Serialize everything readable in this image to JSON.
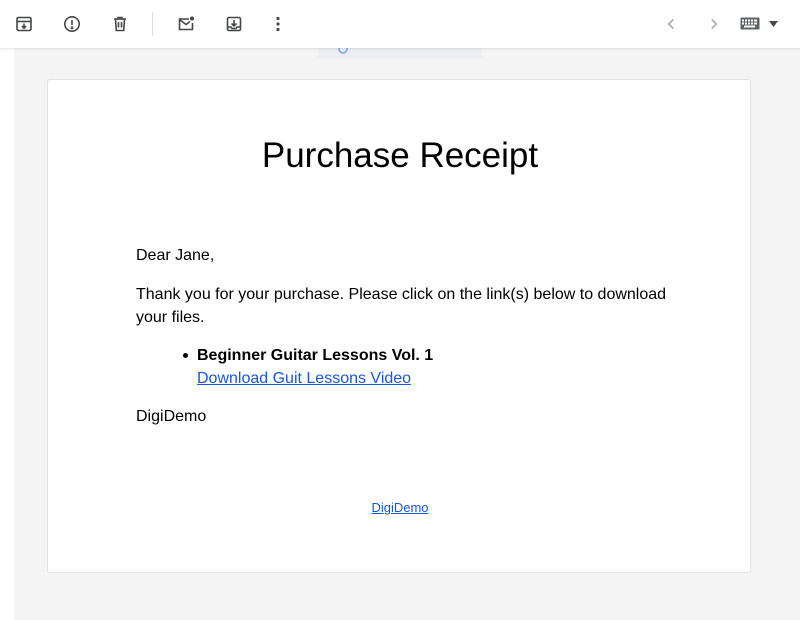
{
  "toolbar": {
    "icons": [
      "archive-icon",
      "report-spam-icon",
      "delete-icon",
      "mark-unread-icon",
      "move-to-icon",
      "more-vert-icon",
      "chevron-left-icon",
      "chevron-right-icon",
      "keyboard-icon",
      "arrow-drop-down-icon"
    ]
  },
  "email": {
    "title": "Purchase Receipt",
    "greeting": "Dear Jane,",
    "intro": "Thank you for your purchase. Please click on the link(s) below to download your files.",
    "items": [
      {
        "name": "Beginner Guitar Lessons Vol. 1",
        "link_text": "Download Guit Lessons Video"
      }
    ],
    "signoff": "DigiDemo",
    "footer_link": "DigiDemo"
  },
  "colors": {
    "link": "#1a55d6",
    "background": "#f4f4f4",
    "icon": "#444746"
  }
}
